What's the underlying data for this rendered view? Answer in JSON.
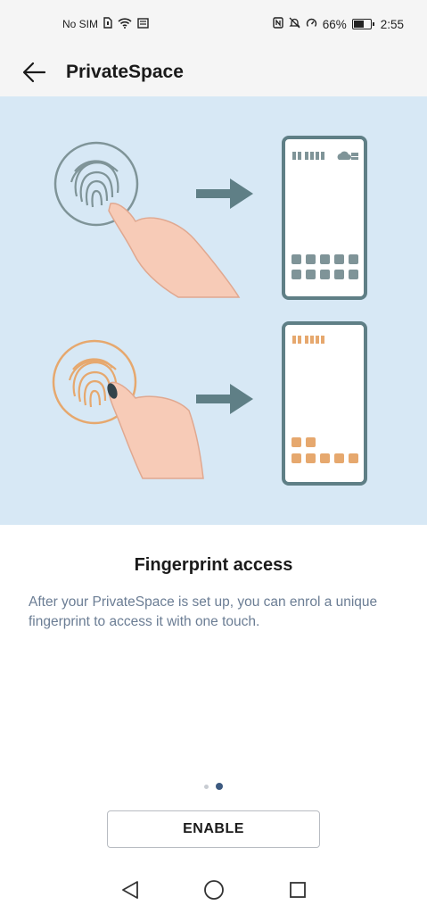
{
  "status_bar": {
    "carrier": "No SIM",
    "battery_percent": "66%",
    "battery_level": 0.66,
    "time": "2:55",
    "icons": [
      "sim-card-icon",
      "wifi-icon",
      "notification-icon",
      "nfc-icon",
      "mute-icon",
      "power-saving-icon",
      "battery-icon"
    ]
  },
  "app_bar": {
    "title": "PrivateSpace",
    "back_icon": "back-arrow-icon"
  },
  "illustration": {
    "top_accent": "#8a9ca8",
    "bottom_accent": "#e6a86e"
  },
  "content": {
    "headline": "Fingerprint access",
    "description": "After your PrivateSpace is set up, you can enrol a unique fingerprint to access it with one touch."
  },
  "pager": {
    "count": 2,
    "active_index": 1
  },
  "actions": {
    "enable_label": "ENABLE"
  },
  "nav_bar": {
    "buttons": [
      "back-triangle-icon",
      "home-circle-icon",
      "recents-square-icon"
    ]
  }
}
